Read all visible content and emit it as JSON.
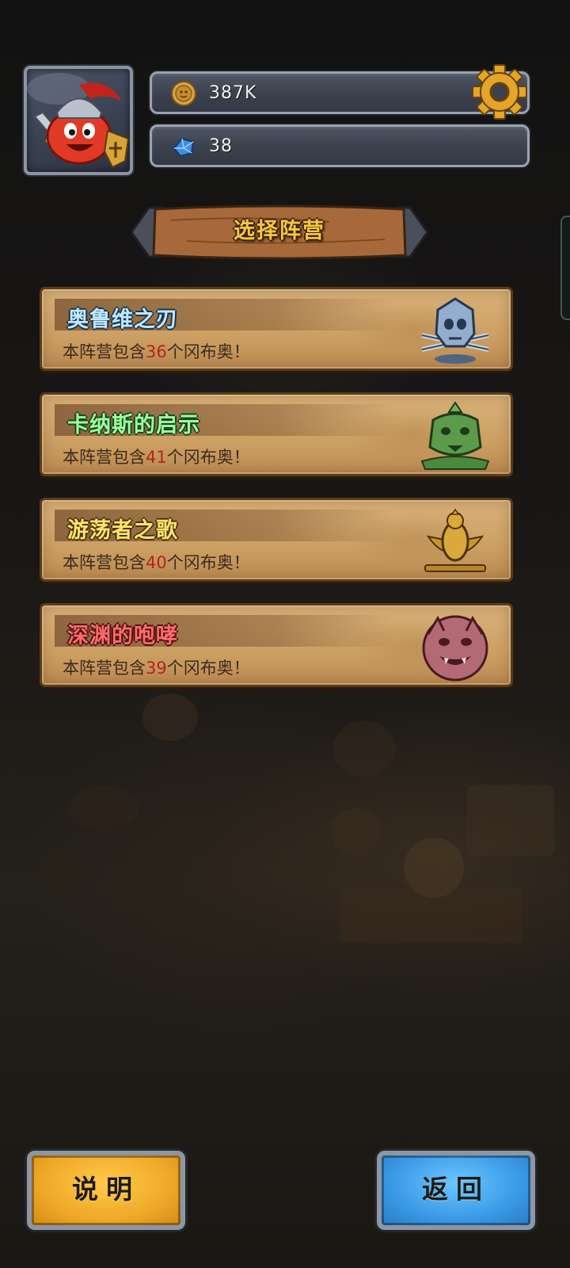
{
  "header": {
    "gold": {
      "icon": "coin-icon",
      "value": "387K"
    },
    "gems": {
      "icon": "crystal-icon",
      "value": "38"
    },
    "settings_icon": "gear-icon",
    "avatar": "red-knight-avatar"
  },
  "title": "选择阵营",
  "factions": [
    {
      "name": "奥鲁维之刃",
      "desc_prefix": "本阵营包含",
      "count": "36",
      "desc_suffix": "个冈布奥！",
      "name_color": "#bfe8ff",
      "emblem": "skull-crossed-swords-emblem"
    },
    {
      "name": "卡纳斯的启示",
      "desc_prefix": "本阵营包含",
      "count": "41",
      "desc_suffix": "个冈布奥！",
      "name_color": "#9cff9c",
      "emblem": "green-beast-emblem"
    },
    {
      "name": "游荡者之歌",
      "desc_prefix": "本阵营包含",
      "count": "40",
      "desc_suffix": "个冈布奥！",
      "name_color": "#ffe46a",
      "emblem": "golden-bird-emblem"
    },
    {
      "name": "深渊的咆哮",
      "desc_prefix": "本阵营包含",
      "count": "39",
      "desc_suffix": "个冈布奥！",
      "name_color": "#ff6a6a",
      "emblem": "demon-face-emblem"
    }
  ],
  "buttons": {
    "help": "说明",
    "back": "返回"
  }
}
